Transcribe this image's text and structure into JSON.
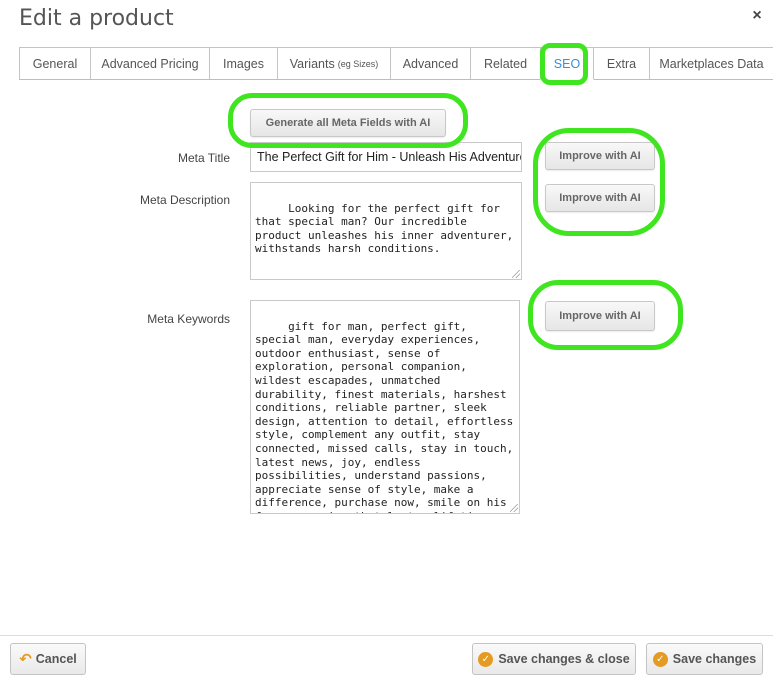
{
  "dialog": {
    "title": "Edit a product",
    "close_glyph": "×"
  },
  "tabs": [
    {
      "label": "General",
      "active": false
    },
    {
      "label": "Advanced Pricing",
      "active": false
    },
    {
      "label": "Images",
      "active": false
    },
    {
      "label": "Variants",
      "note": "(eg Sizes)",
      "active": false
    },
    {
      "label": "Advanced",
      "active": false
    },
    {
      "label": "Related",
      "active": false
    },
    {
      "label": "SEO",
      "active": true
    },
    {
      "label": "Extra",
      "active": false
    },
    {
      "label": "Marketplaces Data",
      "active": false
    }
  ],
  "seo": {
    "generate_all_label": "Generate all Meta Fields with AI",
    "meta_title_label": "Meta Title",
    "meta_title_value": "The Perfect Gift for Him - Unleash His Adventurous Spirit",
    "meta_description_label": "Meta Description",
    "meta_description_value": " Looking for the perfect gift for that special man? Our incredible product unleashes his inner adventurer, withstands harsh conditions.",
    "meta_keywords_label": "Meta Keywords",
    "meta_keywords_value": " gift for man, perfect gift, special man, everyday experiences, outdoor enthusiast, sense of exploration, personal companion, wildest escapades, unmatched durability, finest materials, harshest conditions, reliable partner, sleek design, attention to detail, effortless style, complement any outfit, stay connected, missed calls, stay in touch, latest news, joy, endless possibilities, understand passions, appreciate sense of style, make a difference, purchase now, smile on his face, memories that last a lifetime",
    "improve_label": "Improve with AI"
  },
  "footer": {
    "cancel_label": "Cancel",
    "save_close_label": "Save changes & close",
    "save_label": "Save changes"
  },
  "colors": {
    "highlight": "#3fe51f",
    "active_tab": "#3a8fd0",
    "accent_icon": "#e59a22"
  },
  "icons": {
    "close": "close-icon",
    "undo": "undo-icon",
    "check": "check-circle-icon"
  }
}
